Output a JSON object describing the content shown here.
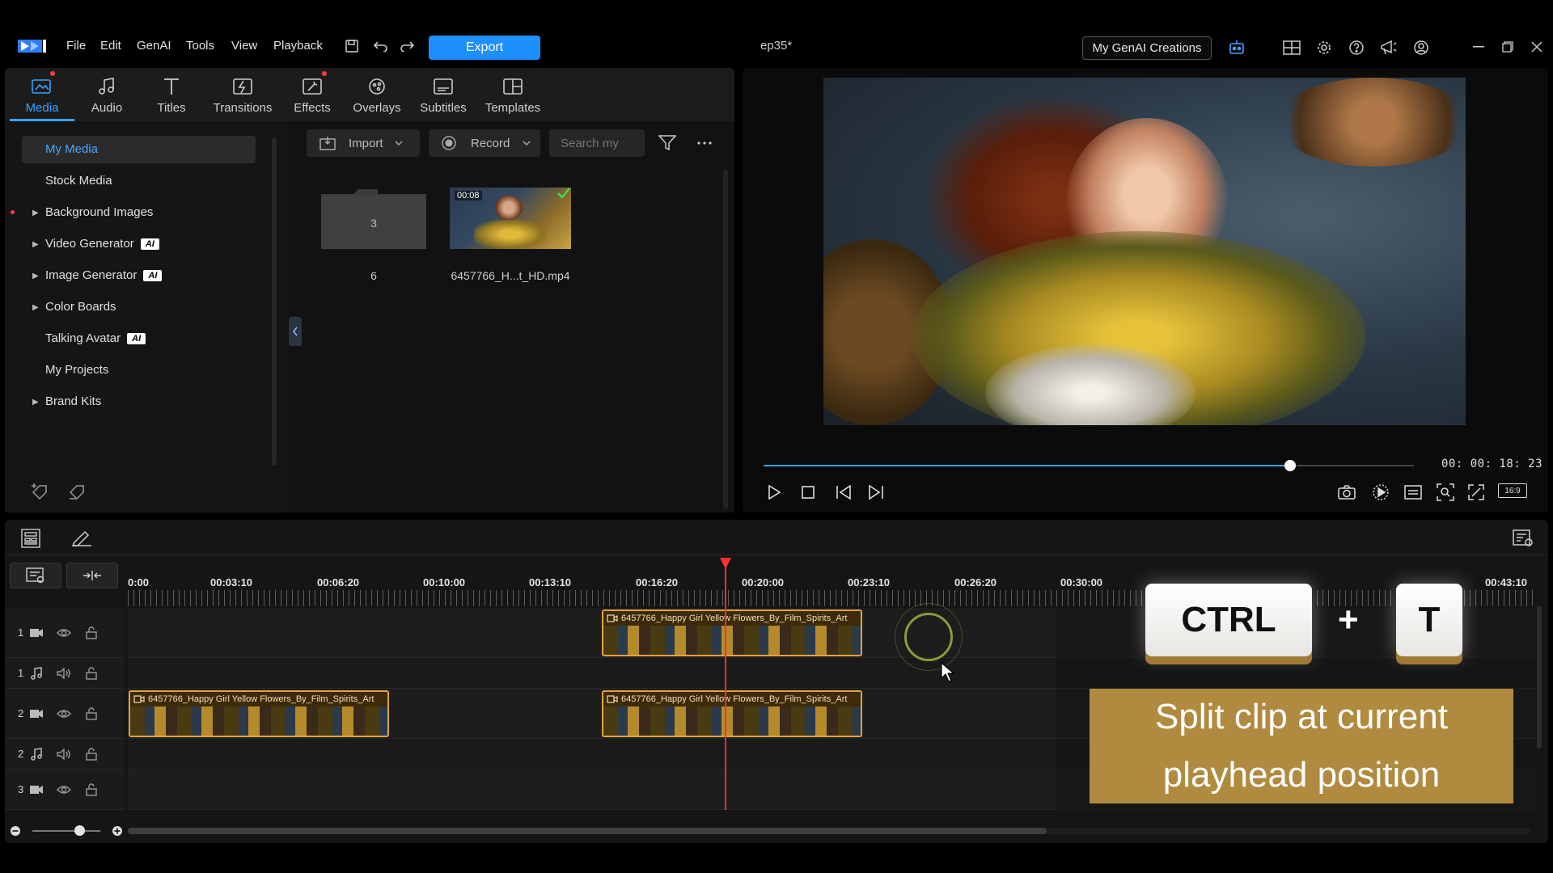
{
  "menu": {
    "items": [
      "File",
      "Edit",
      "GenAI",
      "Tools",
      "View",
      "Playback"
    ],
    "export_label": "Export",
    "project_title": "ep35*",
    "genai_creations_label": "My GenAI Creations"
  },
  "tabs": [
    {
      "label": "Media",
      "icon": "media-icon",
      "active": true
    },
    {
      "label": "Audio",
      "icon": "music-note-icon"
    },
    {
      "label": "Titles",
      "icon": "text-t-icon"
    },
    {
      "label": "Transitions",
      "icon": "transition-icon"
    },
    {
      "label": "Effects",
      "icon": "effects-icon"
    },
    {
      "label": "Overlays",
      "icon": "overlays-icon"
    },
    {
      "label": "Subtitles",
      "icon": "subtitles-icon"
    },
    {
      "label": "Templates",
      "icon": "templates-icon"
    }
  ],
  "library_tree": [
    {
      "label": "My Media",
      "selected": true
    },
    {
      "label": "Stock Media"
    },
    {
      "label": "Background Images",
      "expandable": true
    },
    {
      "label": "Video Generator",
      "expandable": true,
      "badge": "AI"
    },
    {
      "label": "Image Generator",
      "expandable": true,
      "badge": "AI"
    },
    {
      "label": "Color Boards",
      "expandable": true
    },
    {
      "label": "Talking Avatar",
      "badge": "AI"
    },
    {
      "label": "My Projects"
    },
    {
      "label": "Brand Kits",
      "expandable": true
    }
  ],
  "media_toolbar": {
    "import_label": "Import",
    "record_label": "Record",
    "search_placeholder": "Search my"
  },
  "media_items": [
    {
      "type": "folder",
      "count": "3",
      "caption": "6"
    },
    {
      "type": "video",
      "duration": "00:08",
      "caption": "6457766_H...t_HD.mp4",
      "checked": true
    }
  ],
  "preview": {
    "timecode": "00: 00: 18: 23",
    "aspect_label": "16:9",
    "progress": 0.81
  },
  "timeline": {
    "ruler_labels": [
      "0:00",
      "00:03:10",
      "00:06:20",
      "00:10:00",
      "00:13:10",
      "00:16:20",
      "00:20:00",
      "00:23:10",
      "00:26:20",
      "00:30:00",
      "00:43:10"
    ],
    "tracks": [
      {
        "num": "1",
        "kind": "video"
      },
      {
        "num": "1",
        "kind": "audio"
      },
      {
        "num": "2",
        "kind": "video"
      },
      {
        "num": "2",
        "kind": "audio"
      },
      {
        "num": "3",
        "kind": "video"
      }
    ],
    "clip_name": "6457766_Happy Girl Yellow Flowers_By_Film_Spirits_Art"
  },
  "overlay": {
    "key1": "CTRL",
    "plus": "+",
    "key2": "T",
    "caption_line1": "Split clip at current",
    "caption_line2": "playhead position"
  },
  "colors": {
    "accent": "#1d8fff",
    "clip_border": "#e3a43b",
    "playhead": "#ff3030",
    "caption_bg": "#b08a3e"
  }
}
